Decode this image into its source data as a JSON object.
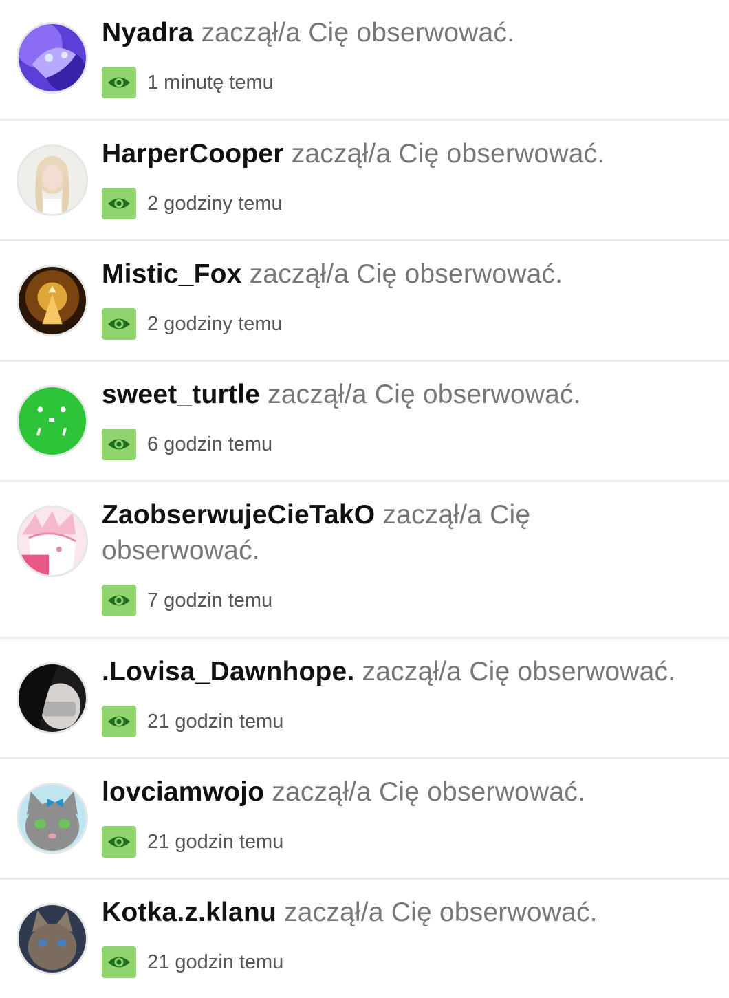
{
  "action_text": "zaczął/a Cię obserwować.",
  "action_text_line1": "zaczął/a Cię",
  "action_text_line2": "obserwować.",
  "accent_color": "#8fd46f",
  "status_icon": "eye-icon",
  "notifications": [
    {
      "username": "Nyadra",
      "time": "1 minutę temu"
    },
    {
      "username": "HarperCooper",
      "time": "2 godziny temu"
    },
    {
      "username": "Mistic_Fox",
      "time": "2 godziny temu"
    },
    {
      "username": "sweet_turtle",
      "time": "6 godzin temu"
    },
    {
      "username": "ZaobserwujeCieTakO",
      "time": "7 godzin temu"
    },
    {
      "username": ".Lovisa_Dawnhope.",
      "time": "21 godzin temu"
    },
    {
      "username": "lovciamwojo",
      "time": "21 godzin temu"
    },
    {
      "username": "Kotka.z.klanu",
      "time": "21 godzin temu"
    }
  ]
}
